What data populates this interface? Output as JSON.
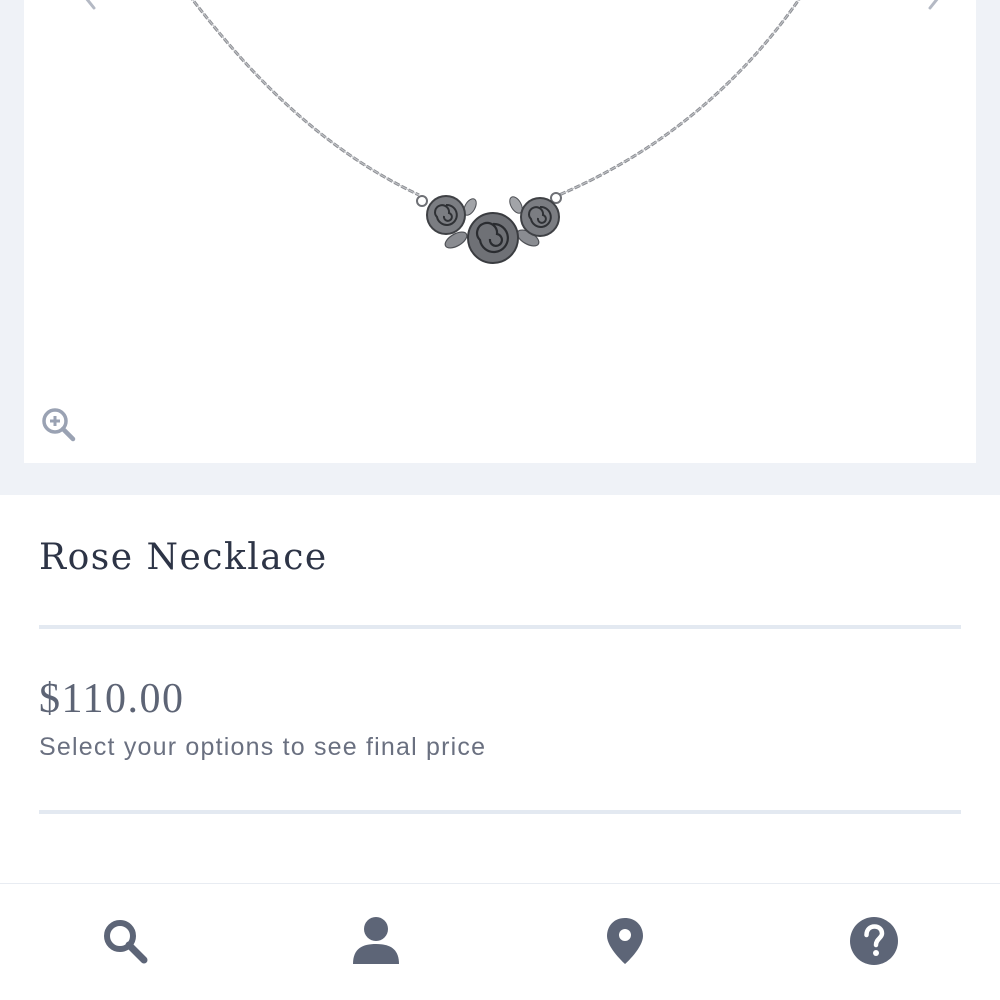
{
  "product": {
    "title": "Rose Necklace",
    "price": "$110.00",
    "price_note": "Select your options to see final price"
  },
  "gallery": {
    "prev_icon": "chevron-left-icon",
    "next_icon": "chevron-right-icon",
    "zoom_icon": "zoom-in-icon"
  },
  "bottom_nav": {
    "items": [
      {
        "icon": "search-icon"
      },
      {
        "icon": "account-icon"
      },
      {
        "icon": "location-pin-icon"
      },
      {
        "icon": "help-icon"
      }
    ]
  },
  "colors": {
    "icon": "#5d6577",
    "background": "#eff2f7",
    "divider": "#e3e9f1",
    "title_text": "#2d3446"
  }
}
